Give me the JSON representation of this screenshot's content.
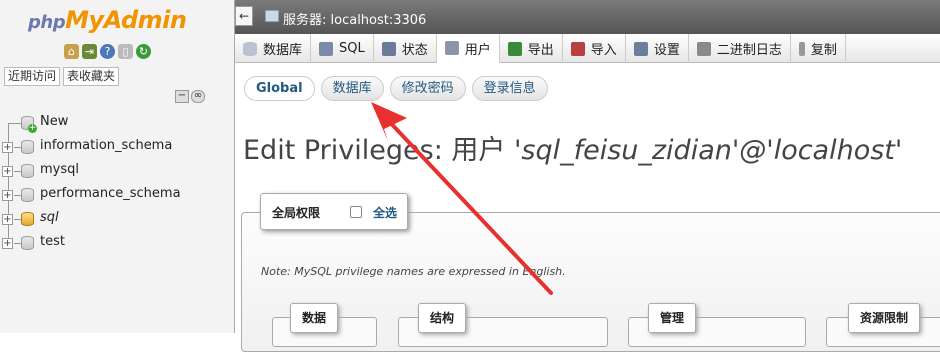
{
  "nav": {
    "logo_php": "php",
    "logo_myadmin": "MyAdmin",
    "quick_icons": [
      "home-icon",
      "exit-icon",
      "help-icon",
      "docs-icon",
      "reload-icon"
    ],
    "tabs": [
      "近期访问",
      "表收藏夹"
    ],
    "databases": [
      {
        "name": "New",
        "icon": "new-db-icon"
      },
      {
        "name": "information_schema",
        "icon": "database-icon"
      },
      {
        "name": "mysql",
        "icon": "database-icon"
      },
      {
        "name": "performance_schema",
        "icon": "database-icon"
      },
      {
        "name": "sql",
        "icon": "database-icon"
      },
      {
        "name": "test",
        "icon": "database-icon"
      }
    ]
  },
  "server_bar": {
    "collapse": "←",
    "label": "服务器: localhost:3306"
  },
  "menu": [
    {
      "label": "数据库",
      "icon": "database-icon",
      "color": "#9aa6b8"
    },
    {
      "label": "SQL",
      "icon": "sql-icon",
      "color": "#7a8aa8"
    },
    {
      "label": "状态",
      "icon": "status-icon",
      "color": "#6b7a96"
    },
    {
      "label": "用户",
      "icon": "users-icon",
      "color": "#8d96a8"
    },
    {
      "label": "导出",
      "icon": "export-icon",
      "color": "#3c8a3c"
    },
    {
      "label": "导入",
      "icon": "import-icon",
      "color": "#b84040"
    },
    {
      "label": "设置",
      "icon": "wrench-icon",
      "color": "#6a7f9a"
    },
    {
      "label": "二进制日志",
      "icon": "binlog-icon",
      "color": "#8a8a8a"
    },
    {
      "label": "复制",
      "icon": "replication-icon",
      "color": "#999999"
    }
  ],
  "menu_active": "用户",
  "subtabs": [
    "Global",
    "数据库",
    "修改密码",
    "登录信息"
  ],
  "subtab_active": "Global",
  "heading": {
    "prefix": "Edit Privileges: 用户 ",
    "account": "'sql_feisu_zidian'@'localhost'"
  },
  "global_privs": {
    "legend": "全局权限",
    "check_all": "全选"
  },
  "note": "Note: MySQL privilege names are expressed in English.",
  "groups": [
    "数据",
    "结构",
    "管理",
    "资源限制"
  ],
  "colors": {
    "link": "#235a81",
    "arrow": "#e8312f",
    "server_bar": "#666666"
  }
}
